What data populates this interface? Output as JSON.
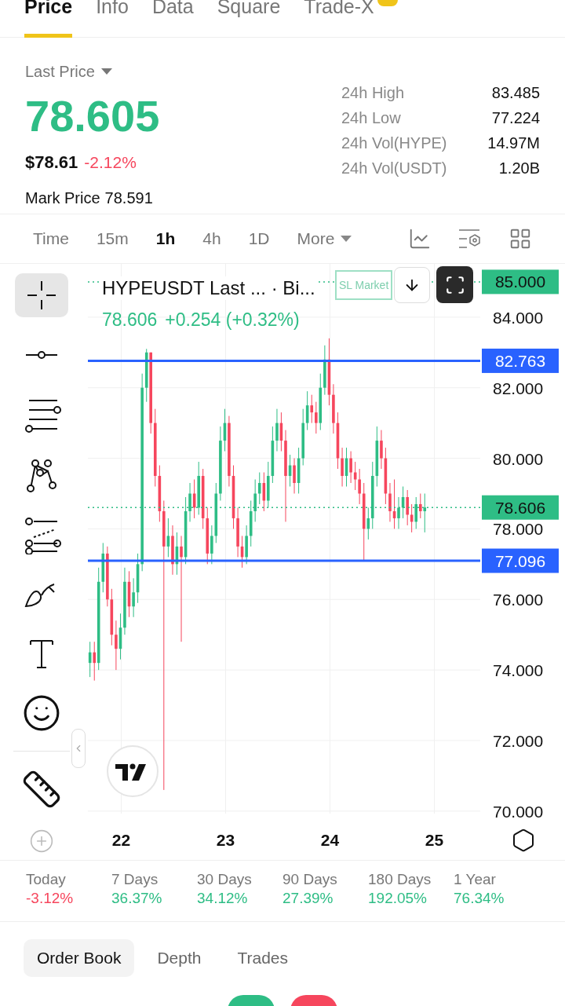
{
  "top_tabs": [
    {
      "label": "Price",
      "selected": true,
      "badge": false
    },
    {
      "label": "Info",
      "selected": false,
      "badge": false
    },
    {
      "label": "Data",
      "selected": false,
      "badge": false
    },
    {
      "label": "Square",
      "selected": false,
      "badge": false
    },
    {
      "label": "Trade-X",
      "selected": false,
      "badge": true
    }
  ],
  "price": {
    "selector": "Last Price",
    "last": "78.605",
    "usd": "$78.61",
    "change": "-2.12%",
    "mark_label": "Mark Price",
    "mark_value": "78.591"
  },
  "stats": [
    {
      "label": "24h High",
      "value": "83.485"
    },
    {
      "label": "24h Low",
      "value": "77.224"
    },
    {
      "label": "24h Vol(HYPE)",
      "value": "14.97M"
    },
    {
      "label": "24h Vol(USDT)",
      "value": "1.20B"
    }
  ],
  "intervals": [
    {
      "label": "Time",
      "selected": false,
      "dropdown": false
    },
    {
      "label": "15m",
      "selected": false,
      "dropdown": false
    },
    {
      "label": "1h",
      "selected": true,
      "dropdown": false
    },
    {
      "label": "4h",
      "selected": false,
      "dropdown": false
    },
    {
      "label": "1D",
      "selected": false,
      "dropdown": false
    },
    {
      "label": "More",
      "selected": false,
      "dropdown": true
    }
  ],
  "tools": [
    {
      "kind": "crosshair",
      "selected": true
    },
    {
      "kind": "hline",
      "selected": false
    },
    {
      "kind": "fib",
      "selected": false
    },
    {
      "kind": "pattern",
      "selected": false
    },
    {
      "kind": "projection",
      "selected": false
    },
    {
      "kind": "brush",
      "selected": false
    },
    {
      "kind": "text",
      "selected": false
    },
    {
      "kind": "emoji",
      "selected": false
    },
    {
      "kind": "ruler",
      "selected": false
    },
    {
      "kind": "add",
      "selected": false
    }
  ],
  "chart": {
    "title": "HYPEUSDT Last ... · Bi...",
    "legend_price": "78.606",
    "legend_change": "+0.254 (+0.32%)",
    "order_tag": "SL Market",
    "price_levels": [
      {
        "label": "85.000",
        "color": "#2ebd85"
      },
      {
        "label": "82.763",
        "color": "#2962ff"
      },
      {
        "label": "78.606",
        "color": "#2ebd85"
      },
      {
        "label": "77.096",
        "color": "#2962ff"
      }
    ],
    "chart_data": {
      "type": "candlestick",
      "grid": true,
      "x": [
        21.7,
        21.742,
        21.783,
        21.825,
        21.867,
        21.908,
        21.95,
        21.992,
        22.033,
        22.075,
        22.117,
        22.158,
        22.2,
        22.242,
        22.283,
        22.325,
        22.367,
        22.408,
        22.45,
        22.492,
        22.533,
        22.575,
        22.617,
        22.658,
        22.7,
        22.742,
        22.783,
        22.825,
        22.867,
        22.908,
        22.95,
        22.992,
        23.033,
        23.075,
        23.117,
        23.158,
        23.2,
        23.242,
        23.283,
        23.325,
        23.367,
        23.408,
        23.45,
        23.492,
        23.533,
        23.575,
        23.617,
        23.658,
        23.7,
        23.742,
        23.783,
        23.825,
        23.867,
        23.908,
        23.95,
        23.992,
        24.033,
        24.075,
        24.117,
        24.158,
        24.2,
        24.242,
        24.283,
        24.325,
        24.367,
        24.408,
        24.45,
        24.492,
        24.533,
        24.575,
        24.617,
        24.658,
        24.7,
        24.742,
        24.783,
        24.825,
        24.867,
        24.908
      ],
      "xlim": [
        21.68,
        25.44
      ],
      "ylim": [
        69.93,
        85.51
      ],
      "ohlc": [
        [
          74.2,
          74.8,
          73.8,
          74.5
        ],
        [
          74.5,
          74.8,
          73.7,
          74.2
        ],
        [
          74.2,
          76.9,
          74.0,
          76.5
        ],
        [
          76.5,
          77.6,
          76.2,
          77.3
        ],
        [
          77.3,
          77.5,
          75.8,
          76.0
        ],
        [
          76.0,
          76.3,
          74.7,
          75.0
        ],
        [
          75.0,
          75.4,
          74.0,
          74.6
        ],
        [
          74.6,
          75.6,
          74.3,
          75.2
        ],
        [
          75.2,
          76.9,
          75.0,
          76.5
        ],
        [
          76.5,
          76.8,
          75.5,
          75.8
        ],
        [
          75.8,
          76.6,
          75.5,
          76.2
        ],
        [
          76.2,
          77.3,
          75.9,
          77.0
        ],
        [
          77.0,
          82.4,
          76.8,
          82.0
        ],
        [
          82.0,
          83.1,
          81.6,
          83.0
        ],
        [
          83.0,
          83.0,
          80.7,
          81.0
        ],
        [
          81.0,
          81.4,
          79.2,
          79.5
        ],
        [
          79.5,
          79.8,
          78.2,
          78.5
        ],
        [
          78.5,
          78.8,
          70.6,
          77.5
        ],
        [
          77.5,
          78.3,
          77.2,
          77.8
        ],
        [
          77.8,
          78.1,
          76.7,
          77.0
        ],
        [
          77.0,
          77.9,
          76.7,
          77.5
        ],
        [
          77.5,
          77.8,
          74.8,
          77.2
        ],
        [
          77.2,
          78.9,
          77.0,
          78.5
        ],
        [
          78.5,
          79.3,
          78.2,
          79.0
        ],
        [
          79.0,
          79.4,
          78.3,
          78.6
        ],
        [
          78.6,
          79.9,
          78.4,
          79.5
        ],
        [
          79.5,
          79.7,
          78.0,
          78.3
        ],
        [
          78.3,
          78.6,
          77.0,
          77.3
        ],
        [
          77.3,
          78.1,
          77.0,
          77.8
        ],
        [
          77.8,
          79.3,
          77.6,
          79.0
        ],
        [
          79.0,
          80.9,
          78.8,
          80.5
        ],
        [
          80.5,
          81.4,
          80.2,
          81.0
        ],
        [
          81.0,
          81.2,
          79.2,
          79.5
        ],
        [
          79.5,
          79.8,
          78.0,
          78.3
        ],
        [
          78.3,
          78.6,
          77.2,
          77.5
        ],
        [
          77.5,
          77.8,
          76.9,
          77.2
        ],
        [
          77.2,
          78.1,
          77.0,
          77.8
        ],
        [
          77.8,
          78.8,
          77.5,
          78.5
        ],
        [
          78.5,
          79.4,
          78.2,
          79.0
        ],
        [
          79.0,
          79.6,
          78.7,
          79.3
        ],
        [
          79.3,
          79.6,
          78.5,
          78.8
        ],
        [
          78.8,
          79.9,
          78.6,
          79.5
        ],
        [
          79.5,
          80.9,
          79.3,
          80.5
        ],
        [
          80.5,
          81.4,
          80.2,
          81.0
        ],
        [
          81.0,
          81.3,
          80.2,
          80.5
        ],
        [
          80.5,
          80.8,
          78.2,
          79.5
        ],
        [
          79.5,
          80.1,
          79.2,
          79.8
        ],
        [
          79.8,
          80.0,
          79.0,
          79.3
        ],
        [
          79.3,
          80.3,
          79.0,
          80.0
        ],
        [
          80.0,
          81.4,
          79.8,
          81.0
        ],
        [
          81.0,
          81.9,
          80.8,
          81.5
        ],
        [
          81.5,
          81.8,
          81.0,
          81.3
        ],
        [
          81.3,
          81.6,
          80.7,
          81.0
        ],
        [
          81.0,
          82.4,
          80.8,
          82.0
        ],
        [
          82.0,
          83.2,
          81.8,
          82.8
        ],
        [
          82.8,
          83.4,
          81.5,
          81.8
        ],
        [
          81.8,
          82.1,
          80.7,
          81.0
        ],
        [
          81.0,
          81.3,
          79.7,
          80.0
        ],
        [
          80.0,
          80.3,
          79.2,
          79.5
        ],
        [
          79.5,
          80.3,
          79.2,
          80.0
        ],
        [
          80.0,
          80.2,
          79.3,
          79.6
        ],
        [
          79.6,
          79.9,
          79.1,
          79.4
        ],
        [
          79.4,
          79.7,
          78.7,
          79.0
        ],
        [
          79.0,
          79.3,
          77.1,
          78.0
        ],
        [
          78.0,
          78.6,
          77.7,
          78.3
        ],
        [
          78.3,
          79.9,
          78.0,
          79.5
        ],
        [
          79.5,
          80.9,
          79.2,
          80.5
        ],
        [
          80.5,
          80.8,
          79.7,
          80.0
        ],
        [
          80.0,
          80.3,
          78.7,
          79.0
        ],
        [
          79.0,
          79.3,
          78.2,
          78.5
        ],
        [
          78.5,
          79.4,
          78.0,
          78.3
        ],
        [
          78.3,
          78.9,
          78.0,
          78.6
        ],
        [
          78.6,
          79.2,
          78.3,
          78.9
        ],
        [
          78.9,
          79.1,
          78.1,
          78.4
        ],
        [
          78.4,
          78.7,
          77.9,
          78.2
        ],
        [
          78.2,
          78.9,
          78.0,
          78.7
        ],
        [
          78.7,
          79.0,
          78.3,
          78.5
        ],
        [
          78.5,
          79.0,
          77.9,
          78.606
        ]
      ],
      "xticks": [
        {
          "value": 22,
          "label": "22"
        },
        {
          "value": 23,
          "label": "23"
        },
        {
          "value": 24,
          "label": "24"
        },
        {
          "value": 25,
          "label": "25"
        }
      ],
      "yticks": [
        {
          "value": 84,
          "label": "84.000"
        },
        {
          "value": 82,
          "label": "82.000"
        },
        {
          "value": 80,
          "label": "80.000"
        },
        {
          "value": 78,
          "label": "78.000"
        },
        {
          "value": 76,
          "label": "76.000"
        },
        {
          "value": 74,
          "label": "74.000"
        },
        {
          "value": 72,
          "label": "72.000"
        },
        {
          "value": 70,
          "label": "70.000"
        }
      ]
    }
  },
  "performance": [
    {
      "label": "Today",
      "value": "-3.12%",
      "color": "#f6465d"
    },
    {
      "label": "7 Days",
      "value": "36.37%",
      "color": "#2ebd85"
    },
    {
      "label": "30 Days",
      "value": "34.12%",
      "color": "#2ebd85"
    },
    {
      "label": "90 Days",
      "value": "27.39%",
      "color": "#2ebd85"
    },
    {
      "label": "180 Days",
      "value": "192.05%",
      "color": "#2ebd85"
    },
    {
      "label": "1 Year",
      "value": "76.34%",
      "color": "#2ebd85"
    }
  ],
  "bottom_tabs": [
    {
      "label": "Order Book",
      "selected": true
    },
    {
      "label": "Depth",
      "selected": false
    },
    {
      "label": "Trades",
      "selected": false
    }
  ]
}
